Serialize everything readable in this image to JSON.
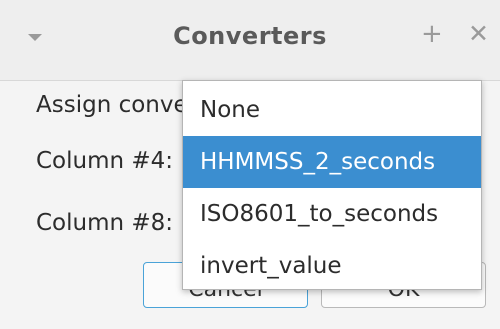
{
  "window": {
    "title": "Converters",
    "menu_icon": "chevron-down-icon",
    "add_icon": "+",
    "close_icon": "✕"
  },
  "content": {
    "assign_label": "Assign conve",
    "column_4_label": "Column #4:",
    "column_8_label": "Column #8:"
  },
  "buttons": {
    "cancel_label": "Cancel",
    "ok_label": "OK"
  },
  "dropdown": {
    "selected_value": "HHMMSS_2_seconds",
    "options": [
      {
        "label": "None"
      },
      {
        "label": "HHMMSS_2_seconds"
      },
      {
        "label": "ISO8601_to_seconds"
      },
      {
        "label": "invert_value"
      }
    ]
  },
  "colors": {
    "selection": "#3b8ed0",
    "focus_border": "#4aa3d8",
    "window_bg": "#f4f4f4"
  }
}
